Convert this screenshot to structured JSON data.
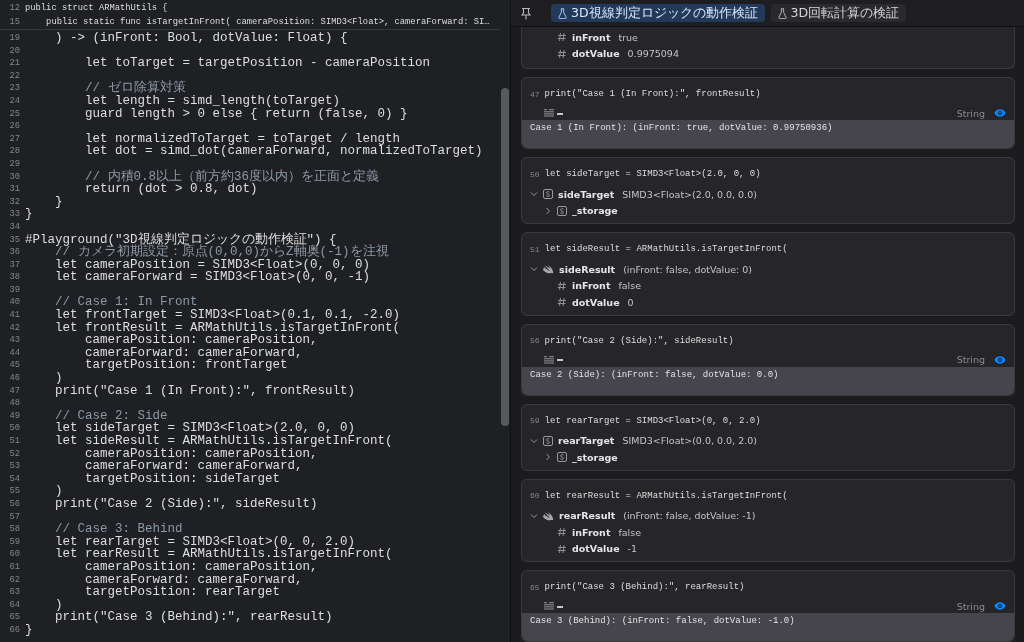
{
  "editor": {
    "pinned_lines": [
      {
        "number": "12",
        "text": "public struct ARMathUtils {"
      },
      {
        "number": "15",
        "text": "    public static func isTargetInFront( cameraPosition: SIMD3<Float>, cameraForward: SI…"
      }
    ],
    "lines": [
      {
        "number": "19",
        "kind": "code",
        "text": "    ) -> (inFront: Bool, dotValue: Float) {"
      },
      {
        "number": "20"
      },
      {
        "number": "21",
        "kind": "code",
        "text": "        let toTarget = targetPosition - cameraPosition"
      },
      {
        "number": "22"
      },
      {
        "number": "23",
        "kind": "comment",
        "text": "        // ゼロ除算対策"
      },
      {
        "number": "24",
        "kind": "code",
        "text": "        let length = simd_length(toTarget)"
      },
      {
        "number": "25",
        "kind": "code",
        "text": "        guard length > 0 else { return (false, 0) }"
      },
      {
        "number": "26"
      },
      {
        "number": "27",
        "kind": "code",
        "text": "        let normalizedToTarget = toTarget / length"
      },
      {
        "number": "28",
        "kind": "code",
        "text": "        let dot = simd_dot(cameraForward, normalizedToTarget)"
      },
      {
        "number": "29"
      },
      {
        "number": "30",
        "kind": "comment",
        "text": "        // 内積0.8以上（前方約36度以内）を正面と定義"
      },
      {
        "number": "31",
        "kind": "code",
        "text": "        return (dot > 0.8, dot)"
      },
      {
        "number": "32",
        "kind": "code",
        "text": "    }"
      },
      {
        "number": "33",
        "kind": "code",
        "text": "}"
      },
      {
        "number": "34"
      },
      {
        "number": "35",
        "kind": "code",
        "text": "#Playground(\"3D視線判定ロジックの動作検証\") {"
      },
      {
        "number": "36",
        "kind": "comment",
        "text": "    // カメラ初期設定：原点(0,0,0)からZ軸奥(-1)を注視"
      },
      {
        "number": "37",
        "kind": "code",
        "text": "    let cameraPosition = SIMD3<Float>(0, 0, 0)"
      },
      {
        "number": "38",
        "kind": "code",
        "text": "    let cameraForward = SIMD3<Float>(0, 0, -1)"
      },
      {
        "number": "39"
      },
      {
        "number": "40",
        "kind": "comment",
        "text": "    // Case 1: In Front"
      },
      {
        "number": "41",
        "kind": "code",
        "text": "    let frontTarget = SIMD3<Float>(0.1, 0.1, -2.0)"
      },
      {
        "number": "42",
        "kind": "code",
        "text": "    let frontResult = ARMathUtils.isTargetInFront("
      },
      {
        "number": "43",
        "kind": "code",
        "text": "        cameraPosition: cameraPosition,"
      },
      {
        "number": "44",
        "kind": "code",
        "text": "        cameraForward: cameraForward,"
      },
      {
        "number": "45",
        "kind": "code",
        "text": "        targetPosition: frontTarget"
      },
      {
        "number": "46",
        "kind": "code",
        "text": "    )"
      },
      {
        "number": "47",
        "kind": "code",
        "text": "    print(\"Case 1 (In Front):\", frontResult)"
      },
      {
        "number": "48"
      },
      {
        "number": "49",
        "kind": "comment",
        "text": "    // Case 2: Side"
      },
      {
        "number": "50",
        "kind": "code",
        "text": "    let sideTarget = SIMD3<Float>(2.0, 0, 0)"
      },
      {
        "number": "51",
        "kind": "code",
        "text": "    let sideResult = ARMathUtils.isTargetInFront("
      },
      {
        "number": "52",
        "kind": "code",
        "text": "        cameraPosition: cameraPosition,"
      },
      {
        "number": "53",
        "kind": "code",
        "text": "        cameraForward: cameraForward,"
      },
      {
        "number": "54",
        "kind": "code",
        "text": "        targetPosition: sideTarget"
      },
      {
        "number": "55",
        "kind": "code",
        "text": "    )"
      },
      {
        "number": "56",
        "kind": "code",
        "text": "    print(\"Case 2 (Side):\", sideResult)"
      },
      {
        "number": "57"
      },
      {
        "number": "58",
        "kind": "comment",
        "text": "    // Case 3: Behind"
      },
      {
        "number": "59",
        "kind": "code",
        "text": "    let rearTarget = SIMD3<Float>(0, 0, 2.0)"
      },
      {
        "number": "60",
        "kind": "code",
        "text": "    let rearResult = ARMathUtils.isTargetInFront("
      },
      {
        "number": "61",
        "kind": "code",
        "text": "        cameraPosition: cameraPosition,"
      },
      {
        "number": "62",
        "kind": "code",
        "text": "        cameraForward: cameraForward,"
      },
      {
        "number": "63",
        "kind": "code",
        "text": "        targetPosition: rearTarget"
      },
      {
        "number": "64",
        "kind": "code",
        "text": "    )"
      },
      {
        "number": "65",
        "kind": "code",
        "text": "    print(\"Case 3 (Behind):\", rearResult)"
      },
      {
        "number": "66",
        "kind": "code",
        "text": "}"
      }
    ]
  },
  "results": {
    "tabs": [
      {
        "label": "3D視線判定ロジックの動作検証",
        "selected": true
      },
      {
        "label": "3D回転計算の検証",
        "selected": false
      }
    ],
    "cards": [
      {
        "kind": "tree",
        "nodes": [
          {
            "kind": "number",
            "name": "inFront",
            "value": "true"
          },
          {
            "kind": "number",
            "name": "dotValue",
            "value": "0.9975094"
          }
        ]
      },
      {
        "kind": "output",
        "line": "47",
        "code": "print(\"Case 1 (In Front):\", frontResult)",
        "type": "String",
        "output": "Case 1 (In Front): (inFront: true, dotValue: 0.99750936)"
      },
      {
        "kind": "tree",
        "line": "50",
        "code": "let sideTarget = SIMD3<Float>(2.0, 0, 0)",
        "nodes": [
          {
            "kind": "struct",
            "name": "sideTarget",
            "value": "SIMD3<Float>(2.0, 0.0, 0.0)",
            "expanded": true,
            "children": [
              {
                "kind": "struct",
                "name": "_storage",
                "expanded": false
              }
            ]
          }
        ]
      },
      {
        "kind": "tree",
        "line": "51",
        "code": "let sideResult = ARMathUtils.isTargetInFront(",
        "nodes": [
          {
            "kind": "tuple",
            "name": "sideResult",
            "value": "(inFront: false, dotValue: 0)",
            "expanded": true,
            "children": [
              {
                "kind": "number",
                "name": "inFront",
                "value": "false"
              },
              {
                "kind": "number",
                "name": "dotValue",
                "value": "0"
              }
            ]
          }
        ]
      },
      {
        "kind": "output",
        "line": "56",
        "code": "print(\"Case 2 (Side):\", sideResult)",
        "type": "String",
        "output": "Case 2 (Side): (inFront: false, dotValue: 0.0)"
      },
      {
        "kind": "tree",
        "line": "59",
        "code": "let rearTarget = SIMD3<Float>(0, 0, 2.0)",
        "nodes": [
          {
            "kind": "struct",
            "name": "rearTarget",
            "value": "SIMD3<Float>(0.0, 0.0, 2.0)",
            "expanded": true,
            "children": [
              {
                "kind": "struct",
                "name": "_storage",
                "expanded": false
              }
            ]
          }
        ]
      },
      {
        "kind": "tree",
        "line": "60",
        "code": "let rearResult = ARMathUtils.isTargetInFront(",
        "nodes": [
          {
            "kind": "tuple",
            "name": "rearResult",
            "value": "(inFront: false, dotValue: -1)",
            "expanded": true,
            "children": [
              {
                "kind": "number",
                "name": "inFront",
                "value": "false"
              },
              {
                "kind": "number",
                "name": "dotValue",
                "value": "-1"
              }
            ]
          }
        ]
      },
      {
        "kind": "output",
        "line": "65",
        "code": "print(\"Case 3 (Behind):\", rearResult)",
        "type": "String",
        "output": "Case 3 (Behind): (inFront: false, dotValue: -1.0)"
      }
    ]
  }
}
